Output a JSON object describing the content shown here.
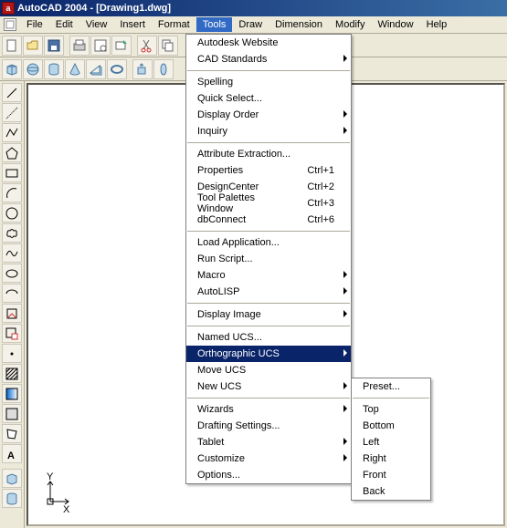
{
  "title": "AutoCAD 2004 - [Drawing1.dwg]",
  "app_icon_letter": "a",
  "menubar": [
    "File",
    "Edit",
    "View",
    "Insert",
    "Format",
    "Tools",
    "Draw",
    "Dimension",
    "Modify",
    "Window",
    "Help"
  ],
  "menubar_open_index": 5,
  "tools_menu": {
    "groups": [
      [
        {
          "label": "Autodesk Website"
        },
        {
          "label": "CAD Standards",
          "sub": true
        }
      ],
      [
        {
          "label": "Spelling"
        },
        {
          "label": "Quick Select..."
        },
        {
          "label": "Display Order",
          "sub": true
        },
        {
          "label": "Inquiry",
          "sub": true
        }
      ],
      [
        {
          "label": "Attribute Extraction..."
        },
        {
          "label": "Properties",
          "shortcut": "Ctrl+1"
        },
        {
          "label": "DesignCenter",
          "shortcut": "Ctrl+2"
        },
        {
          "label": "Tool Palettes Window",
          "shortcut": "Ctrl+3"
        },
        {
          "label": "dbConnect",
          "shortcut": "Ctrl+6"
        }
      ],
      [
        {
          "label": "Load Application..."
        },
        {
          "label": "Run Script..."
        },
        {
          "label": "Macro",
          "sub": true
        },
        {
          "label": "AutoLISP",
          "sub": true
        }
      ],
      [
        {
          "label": "Display Image",
          "sub": true
        }
      ],
      [
        {
          "label": "Named UCS..."
        },
        {
          "label": "Orthographic UCS",
          "sub": true,
          "highlight": true
        },
        {
          "label": "Move UCS"
        },
        {
          "label": "New UCS",
          "sub": true
        }
      ],
      [
        {
          "label": "Wizards",
          "sub": true
        },
        {
          "label": "Drafting Settings..."
        },
        {
          "label": "Tablet",
          "sub": true
        },
        {
          "label": "Customize",
          "sub": true
        },
        {
          "label": "Options..."
        }
      ]
    ]
  },
  "submenu": {
    "groups": [
      [
        {
          "label": "Preset..."
        }
      ],
      [
        {
          "label": "Top"
        },
        {
          "label": "Bottom"
        },
        {
          "label": "Left"
        },
        {
          "label": "Right"
        },
        {
          "label": "Front"
        },
        {
          "label": "Back"
        }
      ]
    ]
  },
  "ucs_labels": {
    "y": "Y",
    "x": "X"
  }
}
